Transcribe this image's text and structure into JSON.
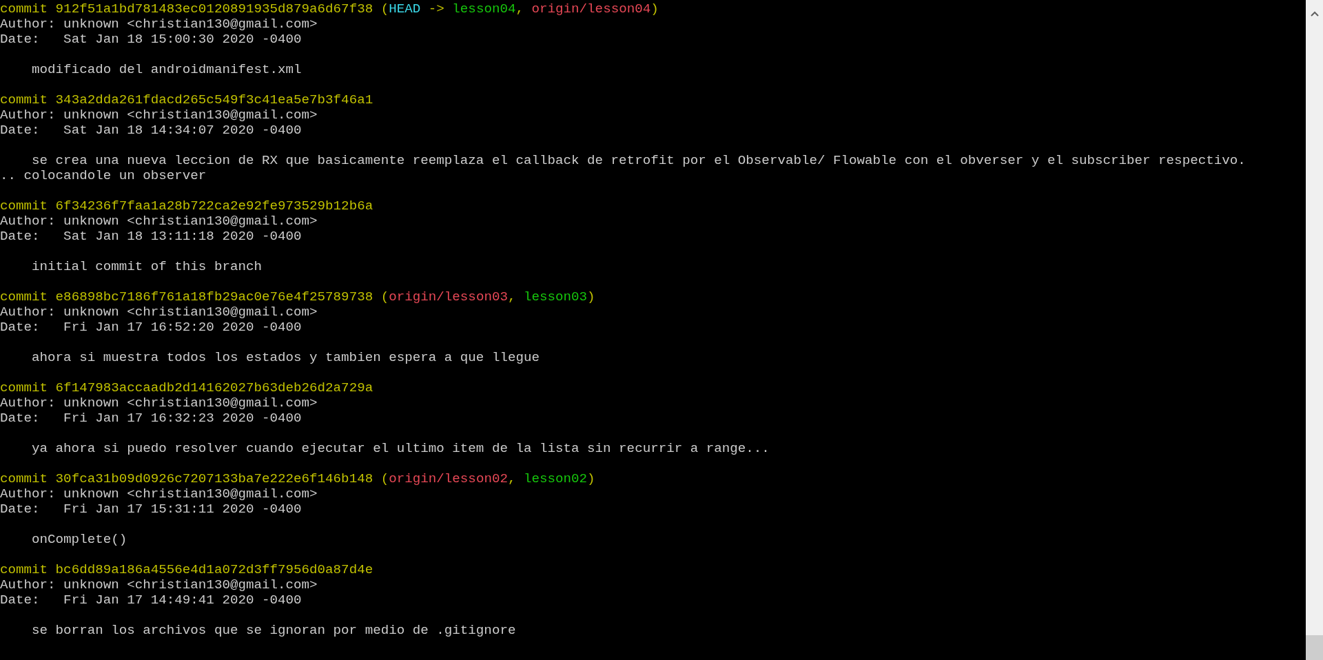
{
  "commits": [
    {
      "header": "commit 912f51a1bd781483ec0120891935d879a6d67f38",
      "decoration": [
        {
          "text": " (",
          "kind": "punct"
        },
        {
          "text": "HEAD",
          "kind": "head"
        },
        {
          "text": " -> ",
          "kind": "punct"
        },
        {
          "text": "lesson04",
          "kind": "local"
        },
        {
          "text": ", ",
          "kind": "punct"
        },
        {
          "text": "origin/lesson04",
          "kind": "remote"
        },
        {
          "text": ")",
          "kind": "punct"
        }
      ],
      "author": "Author: unknown <christian130@gmail.com>",
      "date": "Date:   Sat Jan 18 15:00:30 2020 -0400",
      "message": [
        "modificado del androidmanifest.xml"
      ]
    },
    {
      "header": "commit 343a2dda261fdacd265c549f3c41ea5e7b3f46a1",
      "author": "Author: unknown <christian130@gmail.com>",
      "date": "Date:   Sat Jan 18 14:34:07 2020 -0400",
      "message": [
        "se crea una nueva leccion de RX que basicamente reemplaza el callback de retrofit por el Observable/ Flowable con el obverser y el subscriber respectivo.",
        ".. colocandole un observer"
      ]
    },
    {
      "header": "commit 6f34236f7faa1a28b722ca2e92fe973529b12b6a",
      "author": "Author: unknown <christian130@gmail.com>",
      "date": "Date:   Sat Jan 18 13:11:18 2020 -0400",
      "message": [
        "initial commit of this branch"
      ]
    },
    {
      "header": "commit e86898bc7186f761a18fb29ac0e76e4f25789738",
      "decoration": [
        {
          "text": " (",
          "kind": "punct"
        },
        {
          "text": "origin/lesson03",
          "kind": "remote"
        },
        {
          "text": ", ",
          "kind": "punct"
        },
        {
          "text": "lesson03",
          "kind": "local"
        },
        {
          "text": ")",
          "kind": "punct"
        }
      ],
      "author": "Author: unknown <christian130@gmail.com>",
      "date": "Date:   Fri Jan 17 16:52:20 2020 -0400",
      "message": [
        "ahora si muestra todos los estados y tambien espera a que llegue"
      ]
    },
    {
      "header": "commit 6f147983accaadb2d14162027b63deb26d2a729a",
      "author": "Author: unknown <christian130@gmail.com>",
      "date": "Date:   Fri Jan 17 16:32:23 2020 -0400",
      "message": [
        "ya ahora si puedo resolver cuando ejecutar el ultimo item de la lista sin recurrir a range..."
      ]
    },
    {
      "header": "commit 30fca31b09d0926c7207133ba7e222e6f146b148",
      "decoration": [
        {
          "text": " (",
          "kind": "punct"
        },
        {
          "text": "origin/lesson02",
          "kind": "remote"
        },
        {
          "text": ", ",
          "kind": "punct"
        },
        {
          "text": "lesson02",
          "kind": "local"
        },
        {
          "text": ")",
          "kind": "punct"
        }
      ],
      "author": "Author: unknown <christian130@gmail.com>",
      "date": "Date:   Fri Jan 17 15:31:11 2020 -0400",
      "message": [
        "onComplete()"
      ]
    },
    {
      "header": "commit bc6dd89a186a4556e4d1a072d3ff7956d0a87d4e",
      "author": "Author: unknown <christian130@gmail.com>",
      "date": "Date:   Fri Jan 17 14:49:41 2020 -0400",
      "message": [
        "se borran los archivos que se ignoran por medio de .gitignore"
      ]
    }
  ]
}
